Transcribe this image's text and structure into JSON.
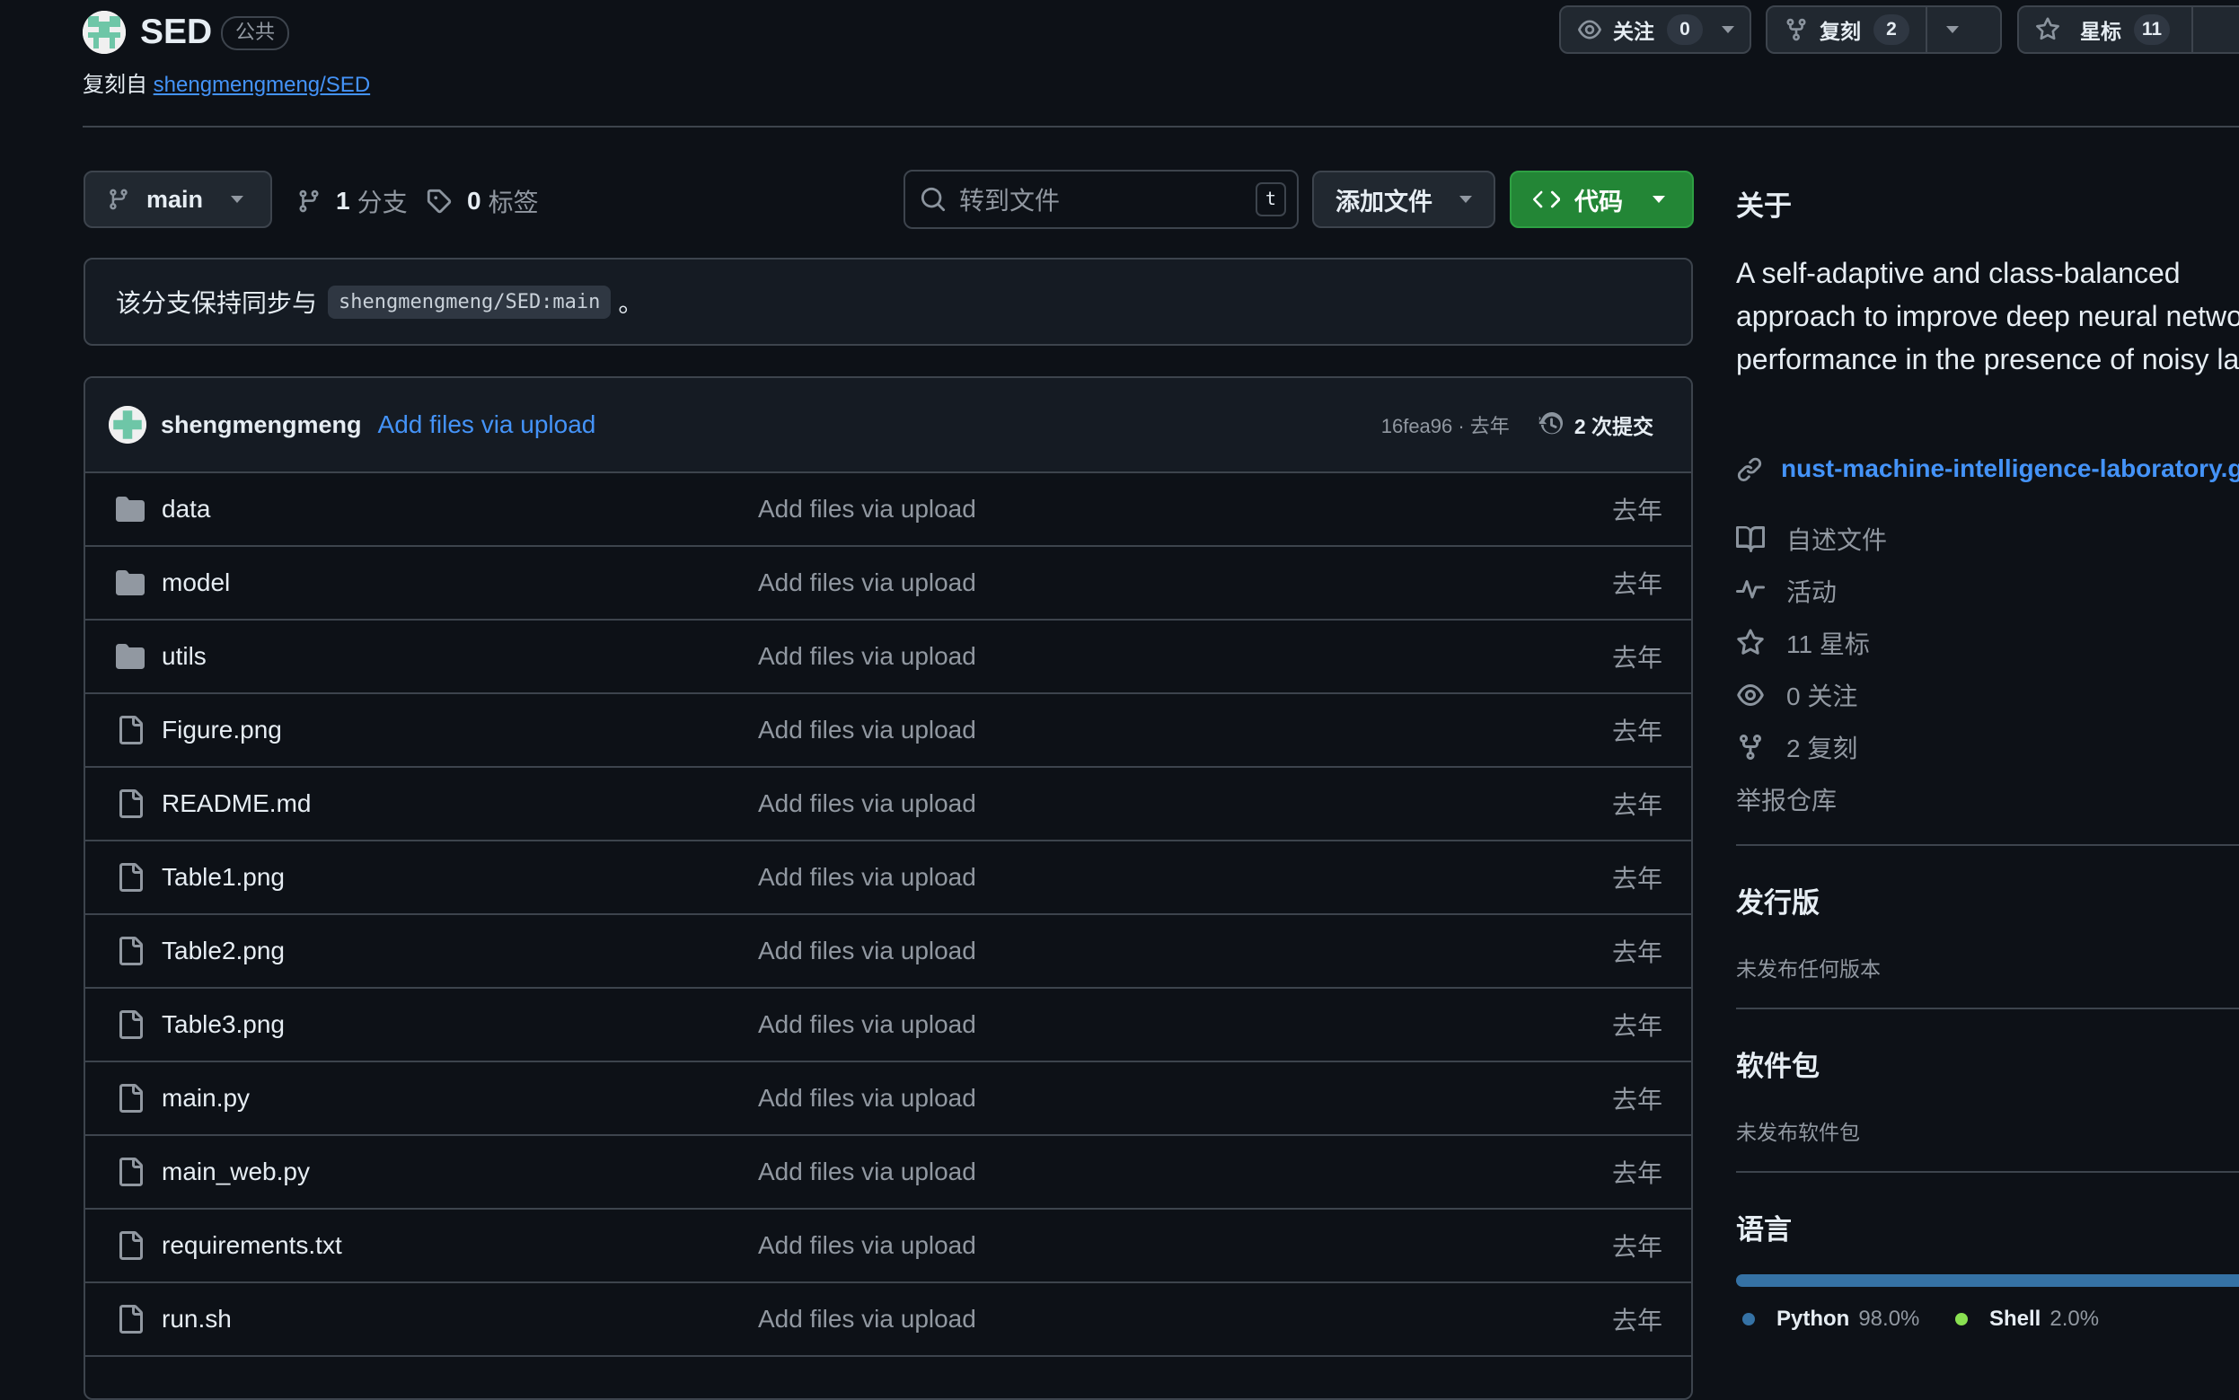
{
  "repo": {
    "name": "SED",
    "visibility": "公共",
    "forked_prefix": "复刻自",
    "forked_from": "shengmengmeng/SED"
  },
  "actions": {
    "watch": {
      "label": "关注",
      "count": "0"
    },
    "fork": {
      "label": "复刻",
      "count": "2"
    },
    "star": {
      "label": "星标",
      "count": "11"
    }
  },
  "toolbar": {
    "branch": "main",
    "branches_count": "1",
    "branches_label": "分支",
    "tags_count": "0",
    "tags_label": "标签",
    "search_placeholder": "转到文件",
    "search_key": "t",
    "add_file": "添加文件",
    "code": "代码"
  },
  "sync": {
    "text": "该分支保持同步与",
    "ref": "shengmengmeng/SED:main",
    "suffix": "。"
  },
  "latest_commit": {
    "user": "shengmengmeng",
    "message": "Add files via upload",
    "hash_time": "16fea96 · 去年",
    "commits": "2 次提交"
  },
  "files": [
    {
      "name": "data",
      "type": "dir",
      "message": "Add files via upload",
      "date": "去年"
    },
    {
      "name": "model",
      "type": "dir",
      "message": "Add files via upload",
      "date": "去年"
    },
    {
      "name": "utils",
      "type": "dir",
      "message": "Add files via upload",
      "date": "去年"
    },
    {
      "name": "Figure.png",
      "type": "file",
      "message": "Add files via upload",
      "date": "去年"
    },
    {
      "name": "README.md",
      "type": "file",
      "message": "Add files via upload",
      "date": "去年"
    },
    {
      "name": "Table1.png",
      "type": "file",
      "message": "Add files via upload",
      "date": "去年"
    },
    {
      "name": "Table2.png",
      "type": "file",
      "message": "Add files via upload",
      "date": "去年"
    },
    {
      "name": "Table3.png",
      "type": "file",
      "message": "Add files via upload",
      "date": "去年"
    },
    {
      "name": "main.py",
      "type": "file",
      "message": "Add files via upload",
      "date": "去年"
    },
    {
      "name": "main_web.py",
      "type": "file",
      "message": "Add files via upload",
      "date": "去年"
    },
    {
      "name": "requirements.txt",
      "type": "file",
      "message": "Add files via upload",
      "date": "去年"
    },
    {
      "name": "run.sh",
      "type": "file",
      "message": "Add files via upload",
      "date": "去年"
    }
  ],
  "sidebar": {
    "about_title": "关于",
    "description": "A self-adaptive and class-balanced approach to improve deep neural network performance in the presence of noisy labels",
    "website": "nust-machine-intelligence-laboratory.git",
    "items": {
      "readme": "自述文件",
      "activity": "活动",
      "stars": "11 星标",
      "watchers": "0 关注",
      "forks": "2 复刻"
    },
    "report": "举报仓库",
    "releases_title": "发行版",
    "releases_empty": "未发布任何版本",
    "packages_title": "软件包",
    "packages_empty": "未发布软件包",
    "languages_title": "语言",
    "languages": [
      {
        "name": "Python",
        "percent": "98.0%",
        "value": 98.0,
        "color": "#3572A5"
      },
      {
        "name": "Shell",
        "percent": "2.0%",
        "value": 2.0,
        "color": "#89E051"
      }
    ]
  }
}
